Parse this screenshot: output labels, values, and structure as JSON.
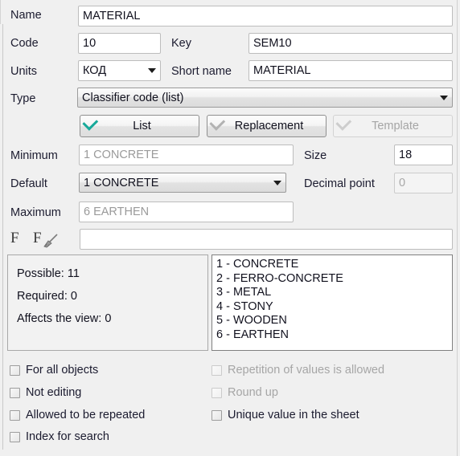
{
  "fields": {
    "name_label": "Name",
    "name_value": "MATERIAL",
    "code_label": "Code",
    "code_value": "10",
    "key_label": "Key",
    "key_value": "SEM10",
    "units_label": "Units",
    "units_value": "КОД",
    "short_name_label": "Short name",
    "short_name_value": "MATERIAL",
    "type_label": "Type",
    "type_value": "Classifier code (list)",
    "minimum_label": "Minimum",
    "minimum_value": "1 CONCRETE",
    "default_label": "Default",
    "default_value": "1 CONCRETE",
    "maximum_label": "Maximum",
    "maximum_value": "6 EARTHEN",
    "size_label": "Size",
    "size_value": "18",
    "decimal_label": "Decimal point",
    "decimal_value": "0",
    "formula_value": ""
  },
  "mode_buttons": [
    {
      "label": "List",
      "checked": true,
      "enabled": true
    },
    {
      "label": "Replacement",
      "checked": true,
      "enabled": true
    },
    {
      "label": "Template",
      "checked": true,
      "enabled": false
    }
  ],
  "formula_icons": {
    "f_plain": "F",
    "f_clear": "F"
  },
  "stats": {
    "possible": "Possible: 11",
    "required": "Required: 0",
    "affects": "Affects the view: 0"
  },
  "classifier_list": [
    "1 - CONCRETE",
    "2 - FERRO-CONCRETE",
    "3 - METAL",
    "4 - STONY",
    "5 - WOODEN",
    "6 - EARTHEN"
  ],
  "checkboxes": {
    "left": [
      {
        "label": "For all objects",
        "checked": false,
        "enabled": true
      },
      {
        "label": "Not editing",
        "checked": false,
        "enabled": true
      },
      {
        "label": "Allowed to be repeated",
        "checked": false,
        "enabled": true
      },
      {
        "label": "Index for search",
        "checked": false,
        "enabled": true
      }
    ],
    "right": [
      {
        "label": "Repetition of values is allowed",
        "checked": false,
        "enabled": false
      },
      {
        "label": "Round up",
        "checked": false,
        "enabled": false
      },
      {
        "label": "Unique value in the sheet",
        "checked": false,
        "enabled": true
      }
    ]
  },
  "colors": {
    "accent_check": "#17a99a",
    "panel_bg": "#f0f0f0",
    "field_bg": "#ffffff",
    "disabled_text": "#a6a6a6"
  }
}
